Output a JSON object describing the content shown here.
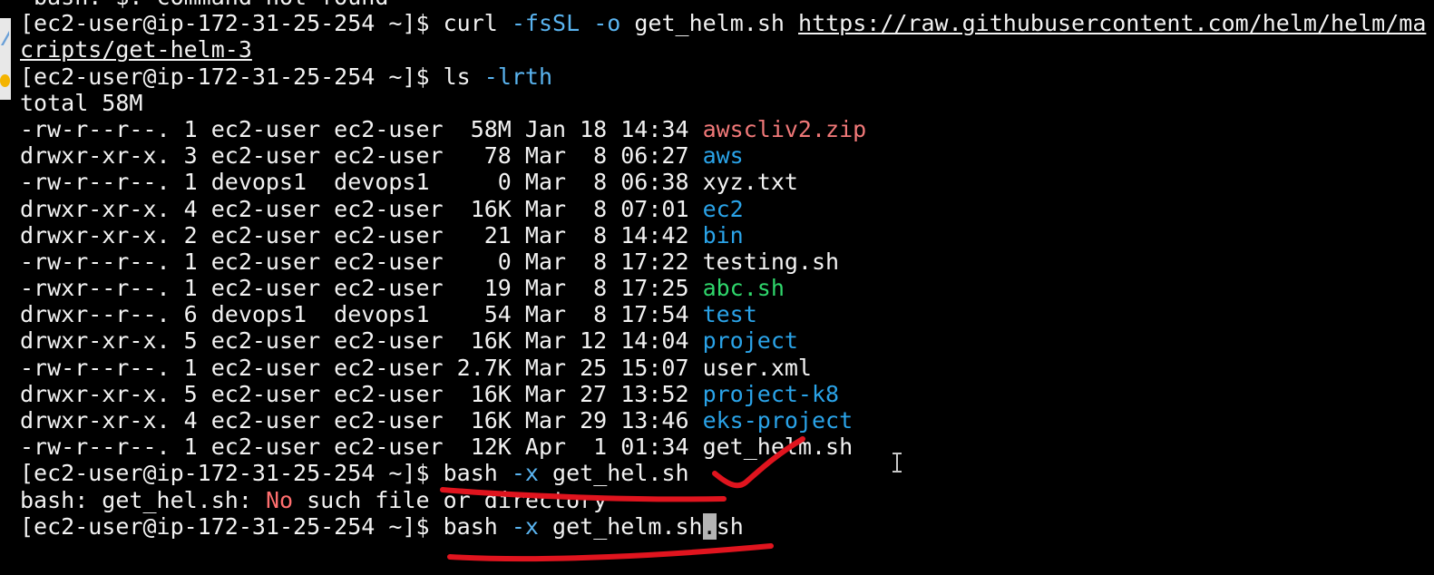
{
  "terminal": {
    "partial_top_line": "-bash: $: command not found",
    "prompt": "[ec2-user@ip-172-31-25-254 ~]$ ",
    "curl_command": {
      "cmd": "curl",
      "opt1": "-fsSL",
      "opt2": "-o",
      "file": "get_helm.sh",
      "url_part1": "https://raw.githubusercontent.com/helm/helm/ma",
      "url_part2": "cripts/get-helm-3"
    },
    "ls_command": {
      "cmd": "ls",
      "opt": "-lrth"
    },
    "total_line": "total 58M",
    "listing": [
      {
        "meta": "-rw-r--r--. 1 ec2-user ec2-user  58M Jan 18 14:34 ",
        "name": "awscliv2.zip",
        "kind": "zip"
      },
      {
        "meta": "drwxr-xr-x. 3 ec2-user ec2-user   78 Mar  8 06:27 ",
        "name": "aws",
        "kind": "dir"
      },
      {
        "meta": "-rw-r--r--. 1 devops1  devops1     0 Mar  8 06:38 ",
        "name": "xyz.txt",
        "kind": "file"
      },
      {
        "meta": "drwxr-xr-x. 4 ec2-user ec2-user  16K Mar  8 07:01 ",
        "name": "ec2",
        "kind": "dir"
      },
      {
        "meta": "drwxr-xr-x. 2 ec2-user ec2-user   21 Mar  8 14:42 ",
        "name": "bin",
        "kind": "dir"
      },
      {
        "meta": "-rw-r--r--. 1 ec2-user ec2-user    0 Mar  8 17:22 ",
        "name": "testing.sh",
        "kind": "file"
      },
      {
        "meta": "-rwxr--r--. 1 ec2-user ec2-user   19 Mar  8 17:25 ",
        "name": "abc.sh",
        "kind": "exe"
      },
      {
        "meta": "drwxr--r--. 6 devops1  devops1    54 Mar  8 17:54 ",
        "name": "test",
        "kind": "dir"
      },
      {
        "meta": "drwxr-xr-x. 5 ec2-user ec2-user  16K Mar 12 14:04 ",
        "name": "project",
        "kind": "dir"
      },
      {
        "meta": "-rw-r--r--. 1 ec2-user ec2-user 2.7K Mar 25 15:07 ",
        "name": "user.xml",
        "kind": "file"
      },
      {
        "meta": "drwxr-xr-x. 5 ec2-user ec2-user  16K Mar 27 13:52 ",
        "name": "project-k8",
        "kind": "dir"
      },
      {
        "meta": "drwxr-xr-x. 4 ec2-user ec2-user  16K Mar 29 13:46 ",
        "name": "eks-project",
        "kind": "dir"
      },
      {
        "meta": "-rw-r--r--. 1 ec2-user ec2-user  12K Apr  1 01:34 ",
        "name": "get_helm.sh",
        "kind": "file"
      }
    ],
    "bash_attempt1": {
      "cmd": "bash",
      "opt": "-x",
      "arg": "get_hel.sh"
    },
    "error_line": {
      "prefix": "bash: get_hel.sh: ",
      "no": "No",
      "rest": " such file or directory"
    },
    "bash_attempt2": {
      "cmd": "bash",
      "opt": "-x",
      "arg_before_cursor": "get_helm.sh",
      "cursor_char": ".",
      "arg_after_cursor": "sh"
    },
    "colors": {
      "background": "#000000",
      "text": "#f2f2f2",
      "option": "#5ab4f0",
      "directory": "#2aa3e8",
      "archive": "#f07878",
      "executable": "#2fd66b",
      "error_word": "#ff6e6e",
      "annotation_ink": "#e0141e"
    },
    "mouse_cursor": "text-ibeam-icon"
  }
}
